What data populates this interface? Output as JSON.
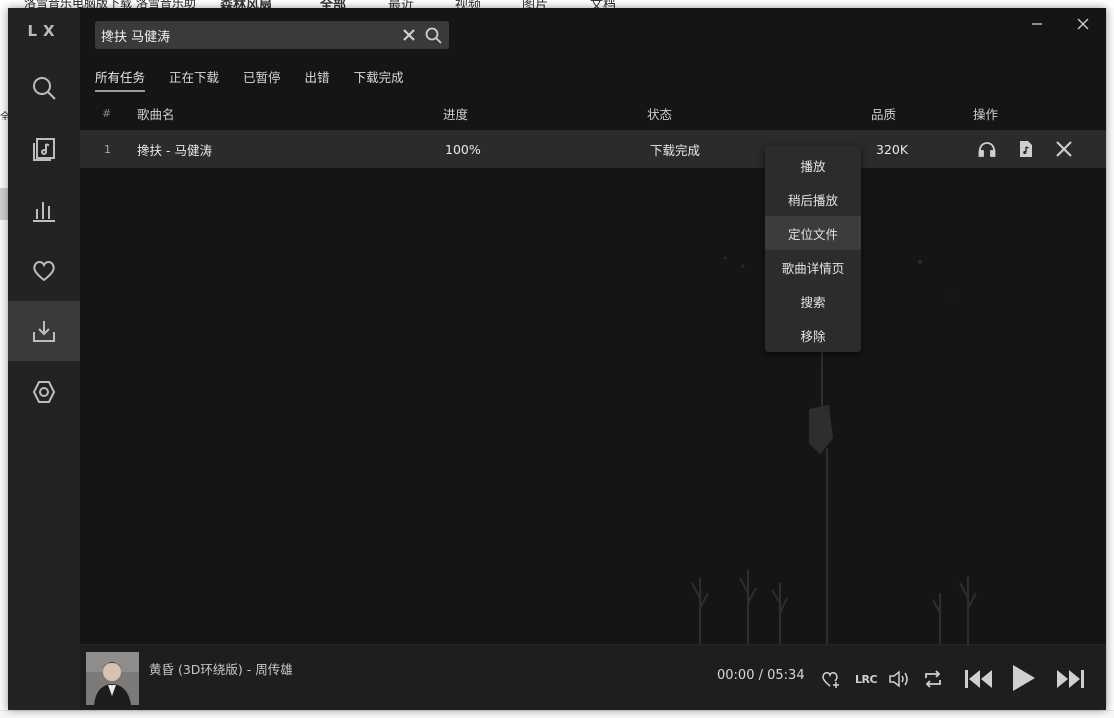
{
  "background": {
    "title": "洛雪音乐电脑版下载 洛雪音乐助",
    "tabs": [
      "森林风扇",
      "全部",
      "最近",
      "视频",
      "图片",
      "文档"
    ],
    "side_text": "全"
  },
  "app": {
    "logo": "LX",
    "nav": [
      {
        "icon": "search-icon",
        "label": "搜索"
      },
      {
        "icon": "song-list-icon",
        "label": "歌单"
      },
      {
        "icon": "leaderboard-icon",
        "label": "排行榜"
      },
      {
        "icon": "heart-icon",
        "label": "我的收藏"
      },
      {
        "icon": "download-icon",
        "label": "下载管理",
        "active": true
      },
      {
        "icon": "settings-icon",
        "label": "设置"
      }
    ],
    "search": {
      "value": "搀扶 马健涛",
      "placeholder": "搜索"
    },
    "window": {
      "minimize": "—",
      "close": "✕"
    },
    "tabs": [
      {
        "label": "所有任务",
        "active": true
      },
      {
        "label": "正在下载"
      },
      {
        "label": "已暂停"
      },
      {
        "label": "出错"
      },
      {
        "label": "下载完成"
      }
    ],
    "table": {
      "headers": {
        "num": "#",
        "name": "歌曲名",
        "progress": "进度",
        "status": "状态",
        "quality": "品质",
        "ops": "操作"
      },
      "rows": [
        {
          "num": "1",
          "name": "搀扶 - 马健涛",
          "progress": "100%",
          "status": "下载完成",
          "quality": "320K"
        }
      ]
    },
    "context_menu": {
      "items": [
        "播放",
        "稍后播放",
        "定位文件",
        "歌曲详情页",
        "搜索",
        "移除"
      ],
      "hover_index": 2
    },
    "player": {
      "title": "黄昏 (3D环绕版) - 周传雄",
      "current_time": "00:00",
      "separator": " / ",
      "duration": "05:34",
      "lyric_button": "LRC"
    }
  },
  "colors": {
    "window_bg": "#141414",
    "sidebar_bg": "#232323",
    "row_bg": "#2b2b2b",
    "menu_bg": "#2c2c2c",
    "text": "#e8e8e8"
  }
}
